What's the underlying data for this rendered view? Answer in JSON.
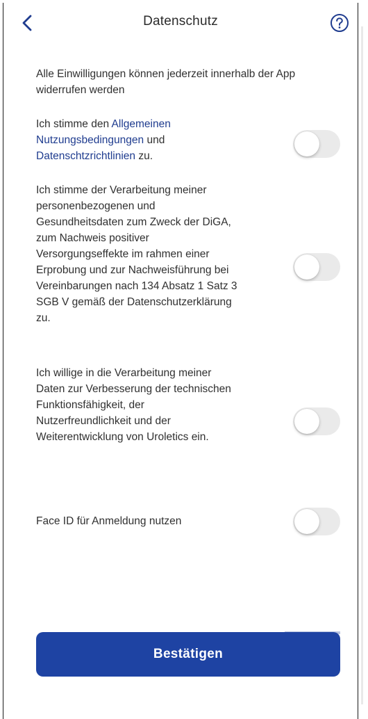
{
  "header": {
    "title": "Datenschutz",
    "back_icon": "chevron-left-icon",
    "help_icon": "question-circle-icon"
  },
  "intro": "Alle Einwilligungen können jederzeit innerhalb der App widerrufen werden",
  "consents": [
    {
      "id": "terms",
      "text_prefix": "Ich stimme den ",
      "link1": "Allgemeinen Nutzungsbedingungen",
      "text_middle": " und ",
      "link2": "Datenschtzrichtlinien",
      "text_suffix": " zu.",
      "enabled": false
    },
    {
      "id": "data-processing",
      "text": "Ich stimme der Verarbeitung meiner personenbezogenen und Gesundheitsdaten zum Zweck der DiGA, zum Nachweis positiver Versorgungseffekte im rahmen einer Erprobung und zur Nachweisführung bei Vereinbarungen nach 134 Absatz 1 Satz 3 SGB V gemäß der Datenschutzerklärung zu.",
      "enabled": false
    },
    {
      "id": "improvement",
      "text": "Ich willige in die Verarbeitung meiner Daten zur Verbesserung der technischen Funktionsfähigkeit, der Nutzerfreundlichkeit und der Weiterentwicklung von Uroletics ein.",
      "enabled": false
    },
    {
      "id": "face-id",
      "text": "Face ID für Anmeldung nutzen",
      "enabled": false
    }
  ],
  "confirm_label": "Bestätigen",
  "colors": {
    "accent": "#1e43a3",
    "link": "#1f3c8f",
    "toggle_off": "#eaeaea",
    "text": "#303030"
  }
}
